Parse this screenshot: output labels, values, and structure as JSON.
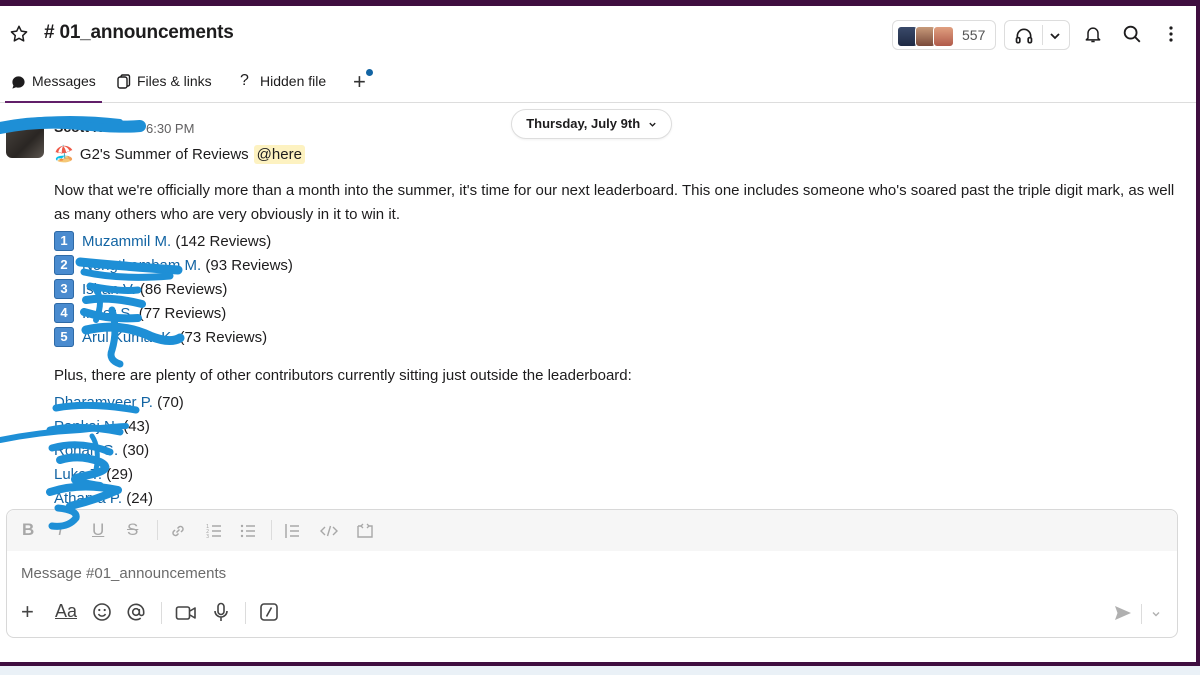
{
  "header": {
    "channel": "# 01_announcements",
    "member_count": "557",
    "icons": [
      "star-icon",
      "headphones-icon",
      "chevron-down-icon",
      "bell-icon",
      "search-icon",
      "more-vertical-icon"
    ]
  },
  "tabs": [
    {
      "label": "Messages",
      "icon": "messages-bubble-icon"
    },
    {
      "label": "Files & links",
      "icon": "files-icon"
    },
    {
      "label": "Hidden file",
      "icon": "question-icon"
    }
  ],
  "message": {
    "sender": "Scott Noble",
    "time": "6:30 PM",
    "date_pill": "Thursday, July 9th",
    "emoji": "🏖️",
    "title": "G2's Summer of Reviews",
    "mention": "@here",
    "body": "Now that we're officially more than a month into the summer, it's time for our next leaderboard. This one includes someone who's soared past the triple digit mark, as well as many others who are very obviously in it to win it.",
    "leaderboard": [
      {
        "num": "1",
        "name": "Muzammil M.",
        "count": " (142 Reviews)"
      },
      {
        "num": "2",
        "name": "Nongthombam M.",
        "count": " (93 Reviews)"
      },
      {
        "num": "3",
        "name": "Ishan V.",
        "count": " (86 Reviews)"
      },
      {
        "num": "4",
        "name": "Inder S.",
        "count": " (77 Reviews)"
      },
      {
        "num": "5",
        "name": "Arul Kumar K.",
        "count": " (73 Reviews)"
      }
    ],
    "plus_text": "Plus, there are plenty of other contributors currently sitting just outside the leaderboard:",
    "contributors": [
      {
        "name": "Dharamveer P.",
        "count": " (70)"
      },
      {
        "name": "Pankaj N.",
        "count": " (43)"
      },
      {
        "name": "Rohan G.",
        "count": " (30)"
      },
      {
        "name": "Luke T.",
        "count": " (29)"
      },
      {
        "name": "Atharva P.",
        "count": " (24)"
      }
    ]
  },
  "composer": {
    "placeholder": "Message #01_announcements",
    "format_icons": [
      "bold-icon",
      "italic-icon",
      "underline-icon",
      "strikethrough-icon",
      "link-icon",
      "ordered-list-icon",
      "bullet-list-icon",
      "blockquote-icon",
      "code-icon",
      "code-block-icon"
    ],
    "actions": [
      "plus-icon",
      "text-format-icon",
      "emoji-icon",
      "mention-icon",
      "video-icon",
      "microphone-icon",
      "slash-command-icon",
      "send-icon",
      "chevron-down-icon"
    ],
    "bold_glyph": "B",
    "italic_glyph": "I",
    "underline_glyph": "U",
    "strike_glyph": "S",
    "format_glyph": "Aa"
  },
  "colors": {
    "frame": "#3f0e40",
    "link": "#1264a3",
    "mention_bg": "#fdf2c1",
    "scribble": "#1e8fd6"
  }
}
